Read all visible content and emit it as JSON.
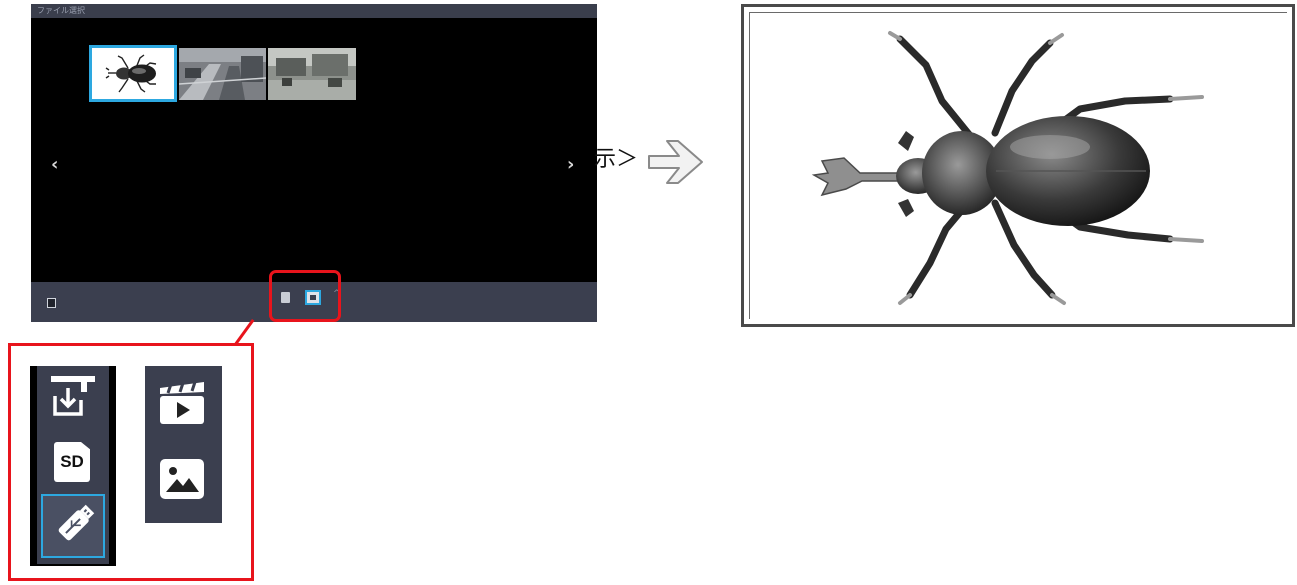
{
  "window": {
    "title": "ファイル選択"
  },
  "navigation": {
    "prev_label": "‹",
    "next_label": "›"
  },
  "thumbnails": [
    {
      "subject": "beetle",
      "selected": true
    },
    {
      "subject": "street-scene-1",
      "selected": false
    },
    {
      "subject": "street-scene-2",
      "selected": false
    }
  ],
  "bottombar": {
    "chevron_label": "^",
    "left_icon": "exit-icon",
    "source_icon": "usb-icon",
    "media_icon": "photo-icon"
  },
  "source_menu": {
    "items": [
      {
        "icon": "download-icon",
        "label": ""
      },
      {
        "icon": "sd-card-icon",
        "label": "SD"
      },
      {
        "icon": "usb-icon",
        "label": "",
        "selected": true
      }
    ]
  },
  "media_menu": {
    "items": [
      {
        "icon": "video-icon"
      },
      {
        "icon": "photo-icon"
      }
    ]
  },
  "annotation": {
    "caption": "示＞",
    "arrow_icon": "right-arrow-icon",
    "highlight_color": "#e8141c",
    "accent_color": "#2da8e0"
  },
  "preview": {
    "subject": "beetle"
  }
}
